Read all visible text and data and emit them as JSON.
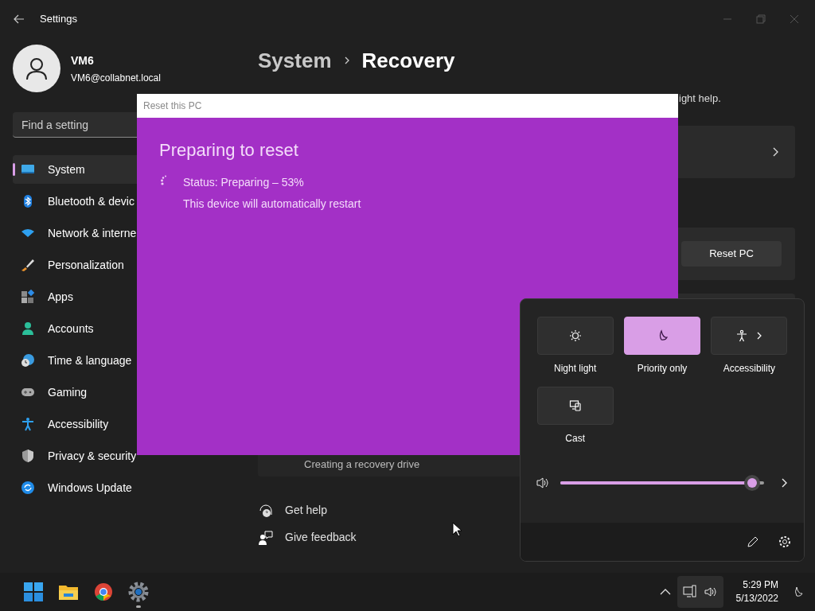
{
  "window": {
    "title": "Settings"
  },
  "user": {
    "name": "VM6",
    "email": "VM6@collabnet.local"
  },
  "search": {
    "placeholder": "Find a setting"
  },
  "nav": [
    {
      "label": "System",
      "selected": true
    },
    {
      "label": "Bluetooth & devic",
      "selected": false
    },
    {
      "label": "Network & interne",
      "selected": false
    },
    {
      "label": "Personalization",
      "selected": false
    },
    {
      "label": "Apps",
      "selected": false
    },
    {
      "label": "Accounts",
      "selected": false
    },
    {
      "label": "Time & language",
      "selected": false
    },
    {
      "label": "Gaming",
      "selected": false
    },
    {
      "label": "Accessibility",
      "selected": false
    },
    {
      "label": "Privacy & security",
      "selected": false
    },
    {
      "label": "Windows Update",
      "selected": false
    }
  ],
  "breadcrumb": {
    "parent": "System",
    "current": "Recovery"
  },
  "description": "ight help.",
  "reset_button": "Reset PC",
  "recovery_drive": "Creating a recovery drive",
  "links": [
    "Get help",
    "Give feedback"
  ],
  "dialog": {
    "title": "Reset this PC",
    "heading": "Preparing to reset",
    "status": "Status: Preparing – 53%",
    "note": "This device will automatically restart"
  },
  "quick_settings": {
    "tiles": [
      {
        "label": "Night light",
        "on": false,
        "arrow": false
      },
      {
        "label": "Priority only",
        "on": true,
        "arrow": false
      },
      {
        "label": "Accessibility",
        "on": false,
        "arrow": true
      },
      {
        "label": "Cast",
        "on": false,
        "arrow": false
      }
    ],
    "volume": {
      "level": 0.98
    }
  },
  "taskbar": {
    "apps": [
      {
        "running": false
      },
      {
        "running": false
      },
      {
        "running": false
      },
      {
        "running": true
      }
    ],
    "time": "5:29 PM",
    "date": "5/13/2022"
  }
}
